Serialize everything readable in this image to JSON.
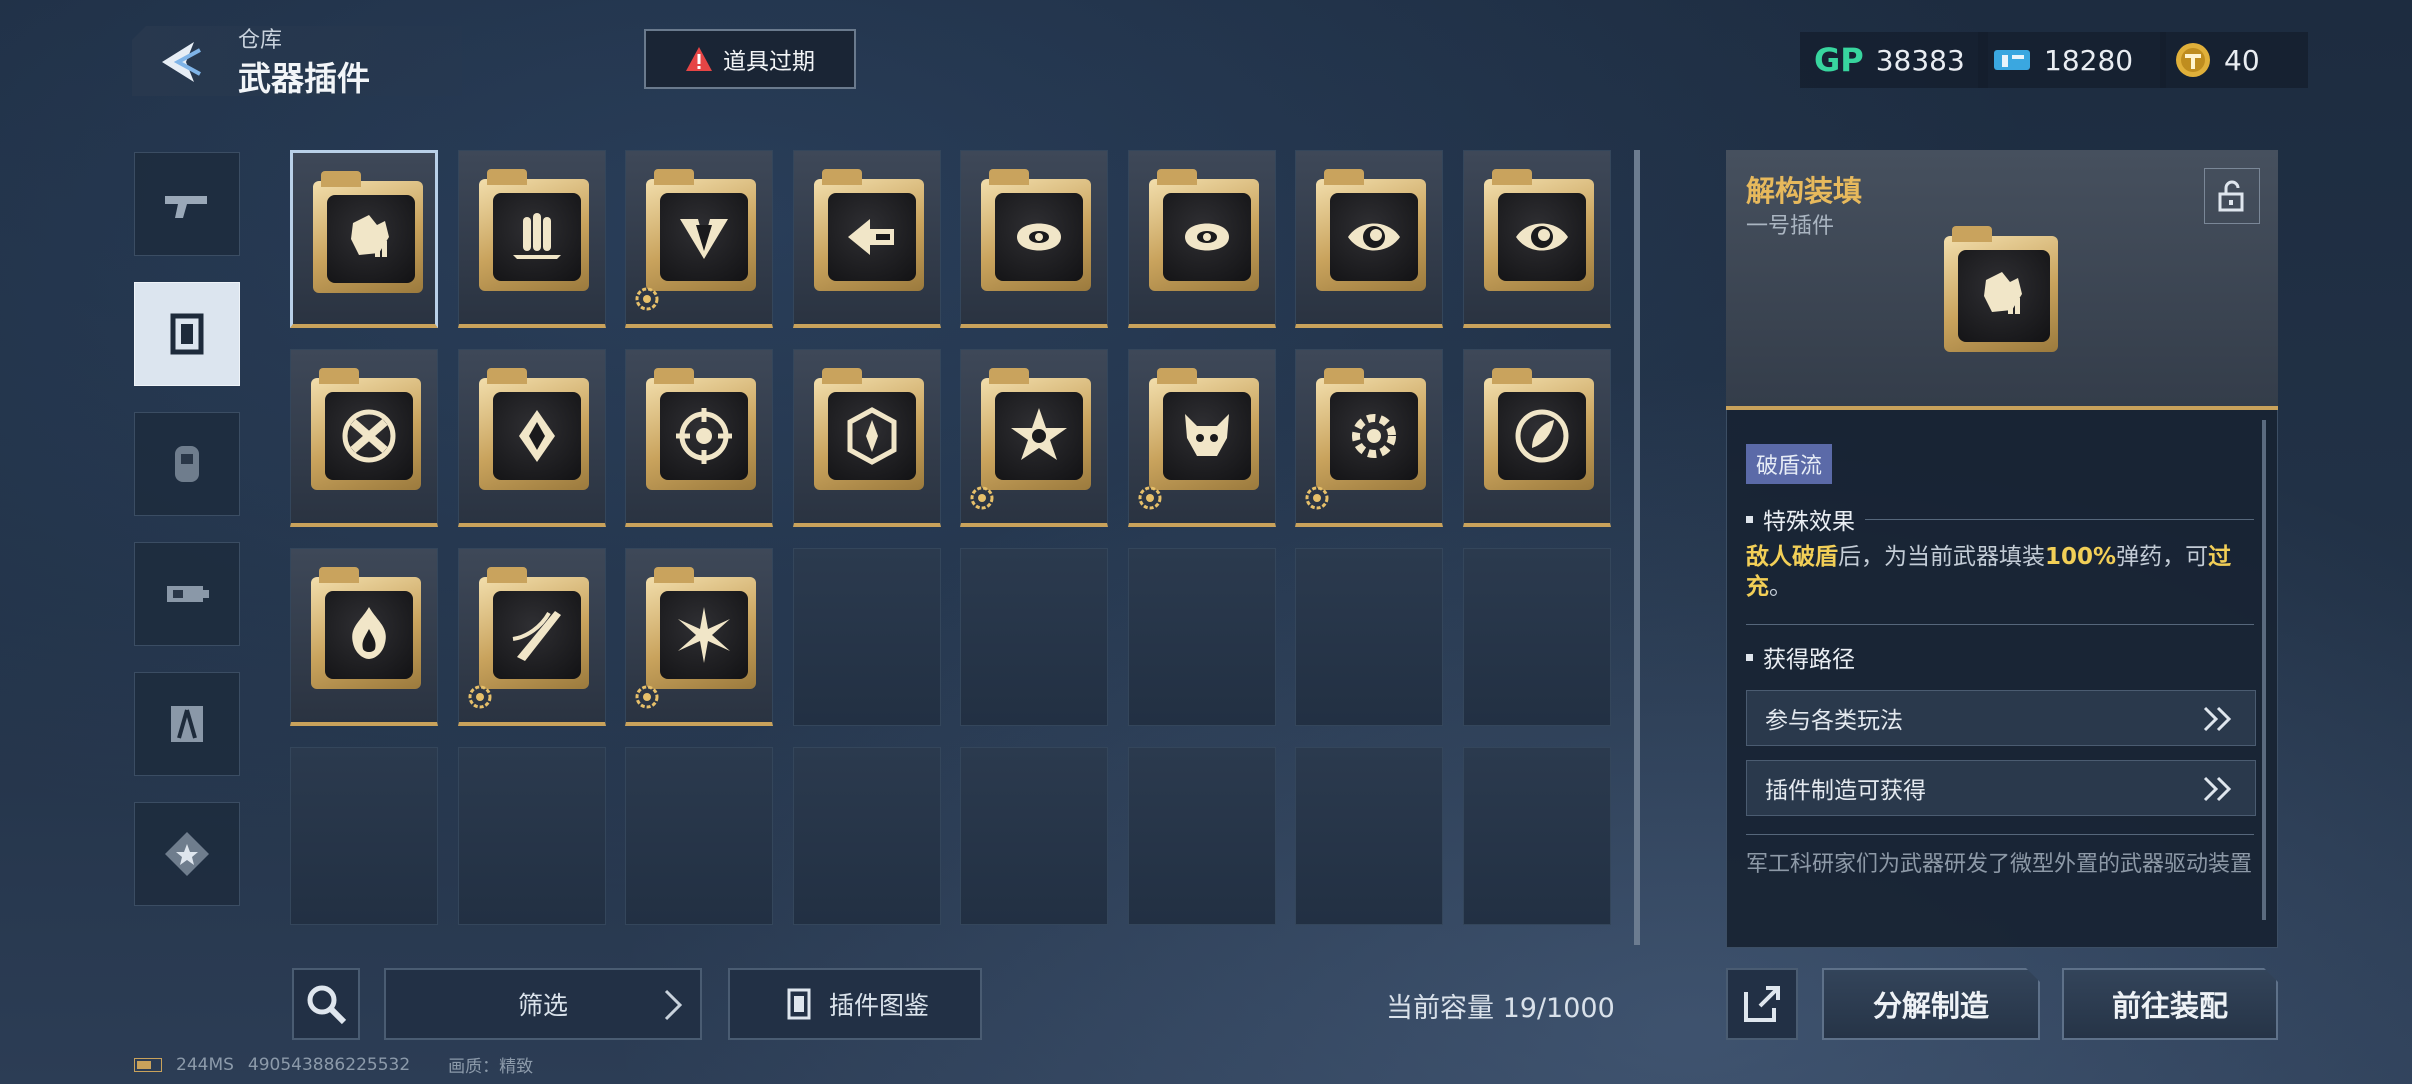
{
  "header": {
    "breadcrumb": "仓库",
    "title": "武器插件",
    "expire_button": "道具过期",
    "currencies": [
      {
        "icon": "gp-currency-icon",
        "label": "GP",
        "value": "38383"
      },
      {
        "icon": "ticket-currency-icon",
        "value": "18280"
      },
      {
        "icon": "coin-currency-icon",
        "value": "40"
      }
    ]
  },
  "categories": [
    {
      "icon": "gun-icon",
      "active": false
    },
    {
      "icon": "plugin-frame-icon",
      "active": true
    },
    {
      "icon": "canister-icon",
      "active": false
    },
    {
      "icon": "weapon-part-icon",
      "active": false
    },
    {
      "icon": "compass-icon",
      "active": false
    },
    {
      "icon": "star-emblem-icon",
      "active": false
    }
  ],
  "plugins": [
    {
      "icon": "fist-shield-icon",
      "badge": false
    },
    {
      "icon": "bullets-icon",
      "badge": false
    },
    {
      "icon": "arrow-down-icon",
      "badge": true
    },
    {
      "icon": "dash-arrow-icon",
      "badge": false
    },
    {
      "icon": "swirl-icon",
      "badge": false
    },
    {
      "icon": "swirl-icon",
      "badge": false
    },
    {
      "icon": "eye-icon",
      "badge": false
    },
    {
      "icon": "eye-icon",
      "badge": false
    },
    {
      "icon": "cross-bullets-icon",
      "badge": false
    },
    {
      "icon": "crystal-icon",
      "badge": false
    },
    {
      "icon": "crosshair-icon",
      "badge": false
    },
    {
      "icon": "hexagon-burst-icon",
      "badge": false
    },
    {
      "icon": "star-hand-icon",
      "badge": true
    },
    {
      "icon": "beast-head-icon",
      "badge": true
    },
    {
      "icon": "gear-spark-icon",
      "badge": true
    },
    {
      "icon": "question-leaf-icon",
      "badge": false
    },
    {
      "icon": "flame-icon",
      "badge": false
    },
    {
      "icon": "slash-icon",
      "badge": true
    },
    {
      "icon": "spark-blast-icon",
      "badge": true
    }
  ],
  "toolbar": {
    "filter_label": "筛选",
    "atlas_label": "插件图鉴",
    "capacity": "当前容量 19/1000"
  },
  "status_bar": {
    "ping": "244MS",
    "id": "490543886225532",
    "quality": "画质：精致"
  },
  "detail": {
    "name": "解构装填",
    "subtitle": "一号插件",
    "tag": "破盾流",
    "effect_heading": "特殊效果",
    "effect": {
      "p1": "敌人破盾",
      "p2": "后，为当前武器填装",
      "p3": "100%",
      "p4": "弹药，可",
      "p5": "过充",
      "p6": "。"
    },
    "route_heading": "获得路径",
    "routes": [
      "参与各类玩法",
      "插件制造可获得"
    ],
    "lore": "军工科研家们为武器研发了微型外置的武器驱动装置"
  },
  "actions": {
    "disassemble": "分解制造",
    "equip": "前往装配"
  }
}
